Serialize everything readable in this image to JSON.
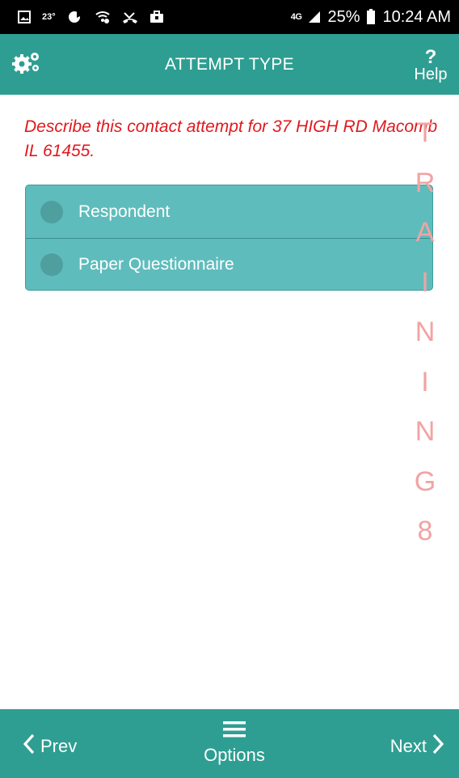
{
  "status_bar": {
    "temperature": "23°",
    "network": "4G",
    "battery_percent": "25%",
    "time": "10:24 AM",
    "icons": [
      "gallery-icon",
      "weather-icon",
      "shield-icon",
      "wifi-icon",
      "missed-call-icon",
      "briefcase-icon",
      "signal-icon",
      "battery-icon"
    ]
  },
  "header": {
    "title": "ATTEMPT TYPE",
    "help_label": "Help",
    "help_symbol": "?",
    "settings_icon": "gears-icon"
  },
  "prompt": {
    "text": "Describe this contact attempt for 37 HIGH RD Macomb IL 61455."
  },
  "options": [
    {
      "label": "Respondent",
      "selected": false
    },
    {
      "label": "Paper Questionnaire",
      "selected": false
    }
  ],
  "watermark": {
    "letters": [
      "T",
      "R",
      "A",
      "I",
      "N",
      "I",
      "N",
      "G",
      "8"
    ],
    "color": "#f2a3a3"
  },
  "bottom_nav": {
    "prev_label": "Prev",
    "options_label": "Options",
    "next_label": "Next"
  },
  "colors": {
    "accent": "#2e9e92",
    "option_bg": "#5fbcbc",
    "prompt_text": "#e0191e"
  }
}
